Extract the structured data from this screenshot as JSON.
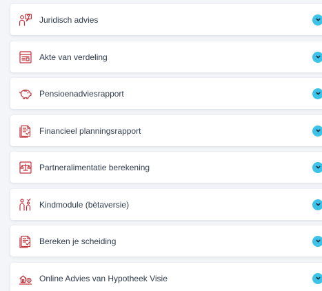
{
  "colors": {
    "icon": "#c2303a",
    "toggle": "#3dc3e8",
    "text": "#2f3b4c",
    "background": "#f3f5f8",
    "card": "#ffffff"
  },
  "items": [
    {
      "label": "Juridisch advies",
      "icon": "legal-advice-icon"
    },
    {
      "label": "Akte van verdeling",
      "icon": "document-icon"
    },
    {
      "label": "Pensioenadviesrapport",
      "icon": "piggy-bank-icon"
    },
    {
      "label": "Financieel planningsrapport",
      "icon": "report-icon"
    },
    {
      "label": "Partneralimentatie berekening",
      "icon": "scales-icon"
    },
    {
      "label": "Kindmodule (bètaversie)",
      "icon": "family-icon"
    },
    {
      "label": "Bereken je scheiding",
      "icon": "calculator-report-icon"
    },
    {
      "label": "Online Advies van Hypotheek Visie",
      "icon": "house-money-icon"
    }
  ]
}
